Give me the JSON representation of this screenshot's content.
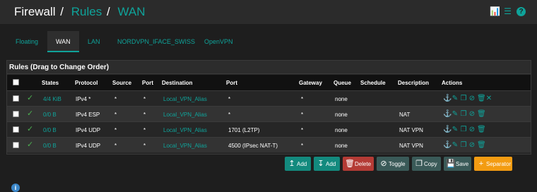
{
  "breadcrumb": {
    "root": "Firewall",
    "sep1": "/",
    "mid": "Rules",
    "sep2": "/",
    "current": "WAN"
  },
  "tabs": [
    {
      "label": "Floating",
      "active": false
    },
    {
      "label": "WAN",
      "active": true
    },
    {
      "label": "LAN",
      "active": false
    },
    {
      "label": "NORDVPN_IFACE_SWISS",
      "active": false
    },
    {
      "label": "OpenVPN",
      "active": false
    }
  ],
  "panel": {
    "title": "Rules (Drag to Change Order)"
  },
  "columns": {
    "states": "States",
    "protocol": "Protocol",
    "source": "Source",
    "port": "Port",
    "destination": "Destination",
    "dport": "Port",
    "gateway": "Gateway",
    "queue": "Queue",
    "schedule": "Schedule",
    "description": "Description",
    "actions": "Actions"
  },
  "rows": [
    {
      "states": "4/4 KiB",
      "protocol": "IPv4 *",
      "source": "*",
      "port": "*",
      "destination": "Local_VPN_Alias",
      "dport": "*",
      "gateway": "*",
      "queue": "none",
      "schedule": "",
      "description": ""
    },
    {
      "states": "0/0 B",
      "protocol": "IPv4 ESP",
      "source": "*",
      "port": "*",
      "destination": "Local_VPN_Alias",
      "dport": "*",
      "gateway": "*",
      "queue": "none",
      "schedule": "",
      "description": "NAT"
    },
    {
      "states": "0/0 B",
      "protocol": "IPv4 UDP",
      "source": "*",
      "port": "*",
      "destination": "Local_VPN_Alias",
      "dport": "1701 (L2TP)",
      "gateway": "*",
      "queue": "none",
      "schedule": "",
      "description": "NAT VPN"
    },
    {
      "states": "0/0 B",
      "protocol": "IPv4 UDP",
      "source": "*",
      "port": "*",
      "destination": "Local_VPN_Alias",
      "dport": "4500 (IPsec NAT-T)",
      "gateway": "*",
      "queue": "none",
      "schedule": "",
      "description": "NAT VPN"
    }
  ],
  "buttons": {
    "add_top": "Add",
    "add_bottom": "Add",
    "delete": "Delete",
    "toggle": "Toggle",
    "copy": "Copy",
    "save": "Save",
    "separator": "Separator"
  },
  "colors": {
    "accent": "#0fa39a",
    "delete": "#b43b35",
    "separator": "#f39c12",
    "pass": "#4caf50"
  },
  "icons": [
    "chart-icon",
    "list-icon",
    "help-icon",
    "anchor-icon",
    "edit-icon",
    "copy-icon",
    "disable-icon",
    "trash-icon",
    "close-icon",
    "info-icon"
  ]
}
